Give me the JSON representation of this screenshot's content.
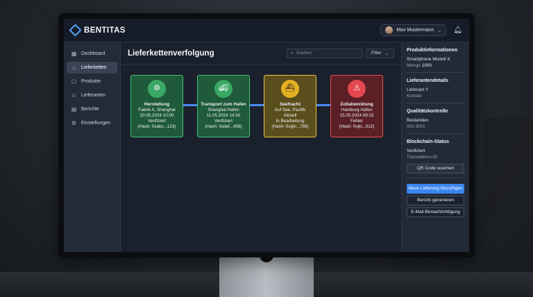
{
  "app": {
    "brand": "BENTITAS"
  },
  "user": {
    "name": "Max Mustermann"
  },
  "sidebar": {
    "items": [
      {
        "label": "Dashboard",
        "icon": "grid-icon",
        "active": false
      },
      {
        "label": "Lieferketten",
        "icon": "network-icon",
        "active": true
      },
      {
        "label": "Produkte",
        "icon": "box-icon",
        "active": false
      },
      {
        "label": "Lieferanten",
        "icon": "people-icon",
        "active": false
      },
      {
        "label": "Berichte",
        "icon": "document-icon",
        "active": false
      },
      {
        "label": "Einstellungen",
        "icon": "gear-icon",
        "active": false
      }
    ]
  },
  "main": {
    "title": "Lieferkettenverfolgung",
    "search_placeholder": "Suchen",
    "filter_label": "Filter"
  },
  "steps": [
    {
      "title": "Herstellung",
      "location": "Fabrik A, Shanghai",
      "date": "10.05.2024 10:00",
      "status": "Verifiziert",
      "hash": "(Hash: 0xabc...123)",
      "color": "#46c27a",
      "icon": "gear-icon"
    },
    {
      "title": "Transport zum Hafen",
      "location": "Shanghai Hafen",
      "date": "11.05.2024 14:30",
      "status": "Verifiziert",
      "hash": "(Hash: 0xdef...456)",
      "color": "#46c27a",
      "icon": "truck-icon"
    },
    {
      "title": "Seefracht",
      "location": "Auf See, Pazifik",
      "date": "Aktuell",
      "status": "In Bearbeitung",
      "hash": "(Hash: 0xghi...789)",
      "color": "#f2c641",
      "icon": "ship-icon"
    },
    {
      "title": "Zollabwicklung",
      "location": "Hamburg Hafen",
      "date": "15.05.2024 09:15",
      "status": "Fehler",
      "hash": "(Hash: 0xjkl...012)",
      "color": "#f04b55",
      "icon": "customs-icon"
    }
  ],
  "panel": {
    "product": {
      "heading": "Produktinformationen",
      "name": "Smartphone Modell X",
      "qty_label": "Menge",
      "qty": "1000"
    },
    "supplier": {
      "heading": "Lieferantendetails",
      "name": "Lieferant Y",
      "contact": "Kontakt"
    },
    "quality": {
      "heading": "Qualitätskontrolle",
      "status": "Bestanden",
      "norm": "ISO 9001"
    },
    "blockchain": {
      "heading": "Blockchain-Status",
      "status": "Verifiziert",
      "tx": "Transaktions-ID",
      "qr_button": "QR Code scannen"
    },
    "buttons": {
      "add": "Neue Lieferung hinzufügen",
      "report": "Bericht generieren",
      "email": "E-Mail-Benachrichtigung"
    }
  }
}
